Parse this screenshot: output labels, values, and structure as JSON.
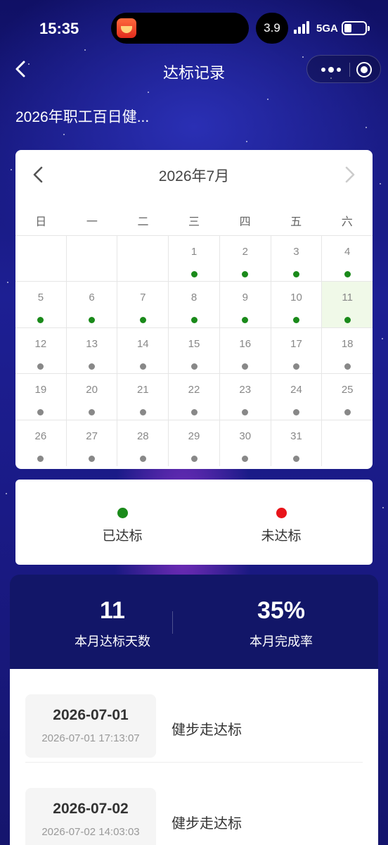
{
  "status_bar": {
    "time": "15:35",
    "speed": "3.9",
    "network": "5GA"
  },
  "nav": {
    "title": "达标记录"
  },
  "subtitle": "2026年职工百日健...",
  "calendar": {
    "month_label": "2026年7月",
    "weekdays": [
      "日",
      "一",
      "二",
      "三",
      "四",
      "五",
      "六"
    ],
    "highlighted_day": "11",
    "rows": [
      [
        {
          "d": "",
          "s": ""
        },
        {
          "d": "",
          "s": ""
        },
        {
          "d": "",
          "s": ""
        },
        {
          "d": "1",
          "s": "green"
        },
        {
          "d": "2",
          "s": "green"
        },
        {
          "d": "3",
          "s": "green"
        },
        {
          "d": "4",
          "s": "green"
        }
      ],
      [
        {
          "d": "5",
          "s": "green"
        },
        {
          "d": "6",
          "s": "green"
        },
        {
          "d": "7",
          "s": "green"
        },
        {
          "d": "8",
          "s": "green"
        },
        {
          "d": "9",
          "s": "green"
        },
        {
          "d": "10",
          "s": "green"
        },
        {
          "d": "11",
          "s": "green"
        }
      ],
      [
        {
          "d": "12",
          "s": "gray"
        },
        {
          "d": "13",
          "s": "gray"
        },
        {
          "d": "14",
          "s": "gray"
        },
        {
          "d": "15",
          "s": "gray"
        },
        {
          "d": "16",
          "s": "gray"
        },
        {
          "d": "17",
          "s": "gray"
        },
        {
          "d": "18",
          "s": "gray"
        }
      ],
      [
        {
          "d": "19",
          "s": "gray"
        },
        {
          "d": "20",
          "s": "gray"
        },
        {
          "d": "21",
          "s": "gray"
        },
        {
          "d": "22",
          "s": "gray"
        },
        {
          "d": "23",
          "s": "gray"
        },
        {
          "d": "24",
          "s": "gray"
        },
        {
          "d": "25",
          "s": "gray"
        }
      ],
      [
        {
          "d": "26",
          "s": "gray"
        },
        {
          "d": "27",
          "s": "gray"
        },
        {
          "d": "28",
          "s": "gray"
        },
        {
          "d": "29",
          "s": "gray"
        },
        {
          "d": "30",
          "s": "gray"
        },
        {
          "d": "31",
          "s": "gray"
        },
        {
          "d": "",
          "s": ""
        }
      ]
    ]
  },
  "legend": {
    "achieved": {
      "label": "已达标",
      "color": "#1a8a1a"
    },
    "not_achieved": {
      "label": "未达标",
      "color": "#e8141a"
    }
  },
  "stats": {
    "days": {
      "value": "11",
      "label": "本月达标天数"
    },
    "rate": {
      "value": "35%",
      "label": "本月完成率"
    }
  },
  "records": [
    {
      "date": "2026-07-01",
      "timestamp": "2026-07-01 17:13:07",
      "text": "健步走达标"
    },
    {
      "date": "2026-07-02",
      "timestamp": "2026-07-02 14:03:03",
      "text": "健步走达标"
    }
  ],
  "colors": {
    "background": "#1b1a7c",
    "stats_panel": "#121668",
    "highlight_cell": "#f0f9e8"
  }
}
